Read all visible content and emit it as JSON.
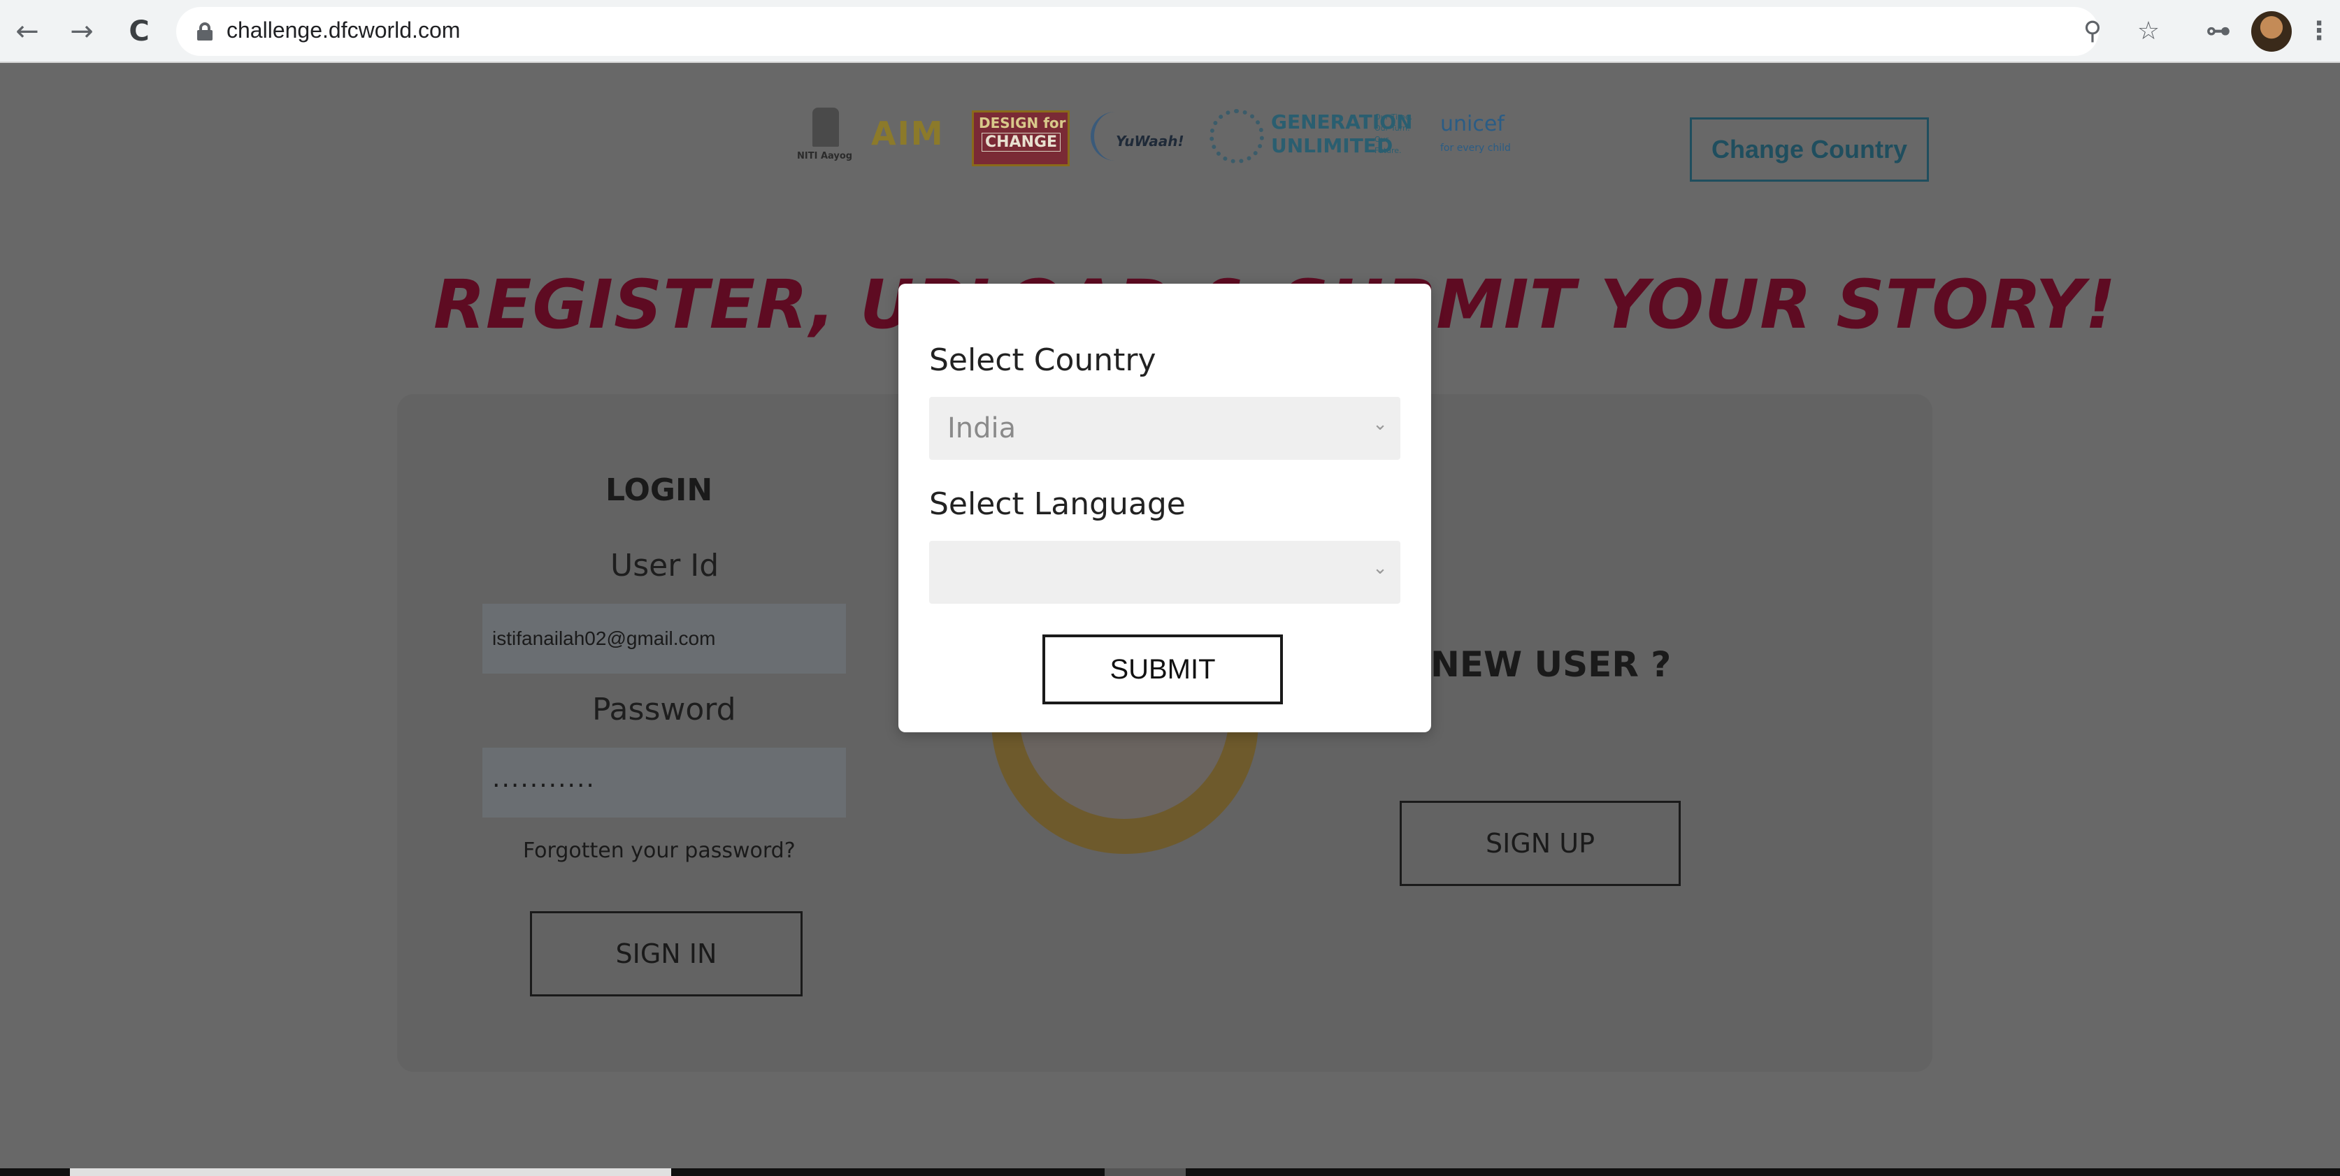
{
  "browser": {
    "url": "challenge.dfcworld.com",
    "back_icon": "←",
    "forward_icon": "→",
    "reload_icon": "C",
    "zoom_icon": "⚲",
    "star_icon": "☆",
    "key_icon": "⊶",
    "menu_icon": "⋮"
  },
  "header": {
    "logos": {
      "emblem_caption": "NITI Aayog",
      "aim": "AIM",
      "dfc_line1": "DESIGN for",
      "dfc_line2": "CHANGE",
      "yuwaah": "YuWaah!",
      "generation_unlimited": "GENERATION UNLIMITED",
      "generation_tagline": "Our Time. Our Turn. Our Future.",
      "unicef": "unicef",
      "unicef_tagline": "for every child"
    },
    "change_country_label": "Change Country"
  },
  "headline": "REGISTER, UPLOAD & SUBMIT YOUR STORY!",
  "login": {
    "title": "LOGIN",
    "userid_label": "User Id",
    "userid_value": "istifanailah02@gmail.com",
    "password_label": "Password",
    "password_value": "...........",
    "forgot_label": "Forgotten your password?",
    "signin_label": "SIGN IN"
  },
  "signup": {
    "title": "NEW USER ?",
    "signup_label": "SIGN UP"
  },
  "modal": {
    "country_label": "Select Country",
    "country_value": "India",
    "language_label": "Select Language",
    "language_value": "",
    "submit_label": "SUBMIT",
    "chevron": "⌄"
  },
  "colors": {
    "overlay_page": "#686868",
    "headline": "#5e0b22",
    "accent": "#1f4e5e",
    "modal_bg": "#ffffff"
  }
}
